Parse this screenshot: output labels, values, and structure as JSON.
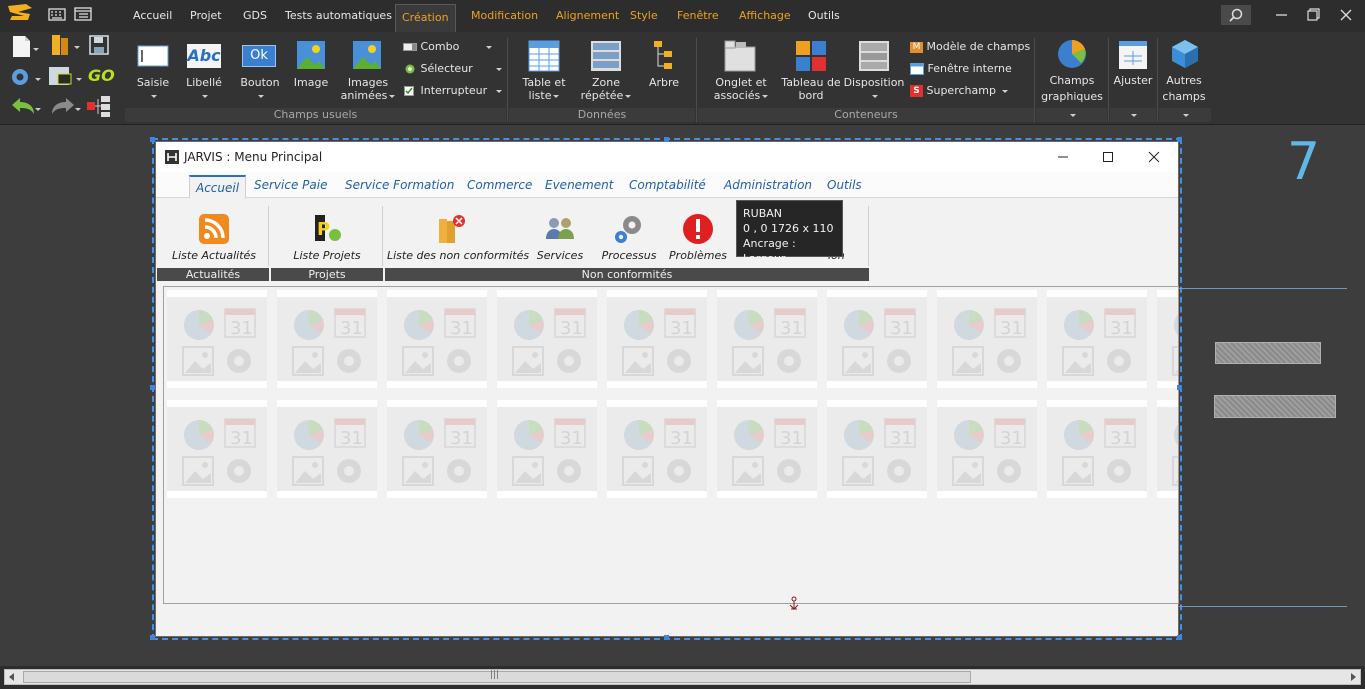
{
  "menubar": {
    "items": [
      {
        "label": "Accueil",
        "style": "normal"
      },
      {
        "label": "Projet",
        "style": "normal"
      },
      {
        "label": "GDS",
        "style": "normal"
      },
      {
        "label": "Tests automatiques",
        "style": "normal"
      },
      {
        "label": "Création",
        "style": "active"
      },
      {
        "label": "Modification",
        "style": "orange"
      },
      {
        "label": "Alignement",
        "style": "orange"
      },
      {
        "label": "Style",
        "style": "orange"
      },
      {
        "label": "Fenêtre",
        "style": "orange"
      },
      {
        "label": "Affichage",
        "style": "orange"
      },
      {
        "label": "Outils",
        "style": "normal"
      }
    ]
  },
  "ribbon": {
    "buttons": {
      "saisie": "Saisie",
      "libelle": "Libellé",
      "bouton": "Bouton",
      "image": "Image",
      "images_animees_1": "Images",
      "images_animees_2": "animées",
      "combo": "Combo",
      "selecteur": "Sélecteur",
      "interrupteur": "Interrupteur",
      "table_liste_1": "Table et",
      "table_liste_2": "liste",
      "zone_repetee_1": "Zone",
      "zone_repetee_2": "répétée",
      "arbre": "Arbre",
      "onglet_1": "Onglet et",
      "onglet_2": "associés",
      "tableau_bord_1": "Tableau de",
      "tableau_bord_2": "bord",
      "disposition": "Disposition",
      "modele_champs": "Modèle de champs",
      "fenetre_interne": "Fenêtre interne",
      "superchamp": "Superchamp",
      "champs_graphiques_1": "Champs",
      "champs_graphiques_2": "graphiques",
      "ajuster": "Ajuster",
      "autres_champs_1": "Autres",
      "autres_champs_2": "champs",
      "abc_icon_text": "Abc",
      "ok_icon_text": "Ok",
      "go_icon_text": "GO"
    },
    "groups": {
      "champs_usuels": "Champs usuels",
      "donnees": "Données",
      "conteneurs": "Conteneurs"
    }
  },
  "editor": {
    "page_number": "7"
  },
  "window": {
    "title": "JARVIS : Menu Principal",
    "tabs": [
      {
        "label": "Accueil",
        "active": true
      },
      {
        "label": "Service Paie",
        "active": false
      },
      {
        "label": "Service Formation",
        "active": false
      },
      {
        "label": "Commerce",
        "active": false
      },
      {
        "label": "Evenement",
        "active": false
      },
      {
        "label": "Comptabilité",
        "active": false
      },
      {
        "label": "Administration",
        "active": false
      },
      {
        "label": "Outils",
        "active": false
      }
    ],
    "ribbon_buttons": [
      {
        "label": "Liste Actualités",
        "icon": "rss-icon"
      },
      {
        "label": "Liste Projets",
        "icon": "projects-icon"
      },
      {
        "label": "Liste des non conformités",
        "icon": "folder-error-icon"
      },
      {
        "label": "Services",
        "icon": "people-icon"
      },
      {
        "label": "Processus",
        "icon": "gears-icon"
      },
      {
        "label": "Problèmes",
        "icon": "alert-icon"
      },
      {
        "label": "ion",
        "icon": ""
      }
    ],
    "ribbon_groups": {
      "actualites": "Actualités",
      "projets": "Projets",
      "non_conformites": "Non conformités"
    },
    "tile_calendar_day": "31"
  },
  "tooltip": {
    "line1": "RUBAN",
    "line2": "0 , 0    1726 x 110",
    "line3": "Ancrage : Largeur"
  },
  "scrollbar": {
    "grip": "|||"
  },
  "colors": {
    "accent_orange": "#f0a020",
    "selection_blue": "#3a86e0",
    "page_number_blue": "#5fb8e8",
    "tab_blue": "#1f5fa8"
  }
}
